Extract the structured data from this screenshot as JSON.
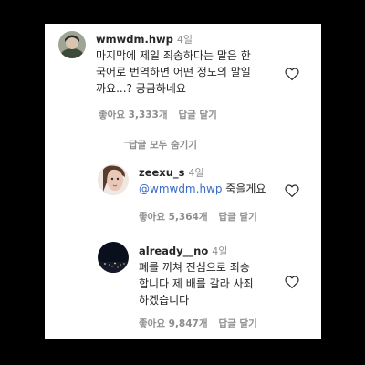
{
  "comments": [
    {
      "username": "wmwdm.hwp",
      "time": "4일",
      "text": "마지막에 제일 죄송하다는 말은 한\n국어로 번역하면 어떤 정도의 말일\n까요...? 궁금하네요",
      "likes_label": "좋아요 3,333개",
      "reply_label": "답글 달기"
    }
  ],
  "hide_replies_label": "답글 모두 숨기기",
  "replies": [
    {
      "username": "zeexu_s",
      "time": "4일",
      "mention": "@wmwdm.hwp",
      "text": " 죽을게요",
      "likes_label": "좋아요 5,364개",
      "reply_label": "답글 달기"
    },
    {
      "username": "already__no",
      "time": "4일",
      "text": "폐를 끼쳐 진심으로 죄송\n합니다 제 배를 갈라 사죄\n하겠습니다",
      "likes_label": "좋아요 9,847개",
      "reply_label": "답글 달기"
    }
  ]
}
